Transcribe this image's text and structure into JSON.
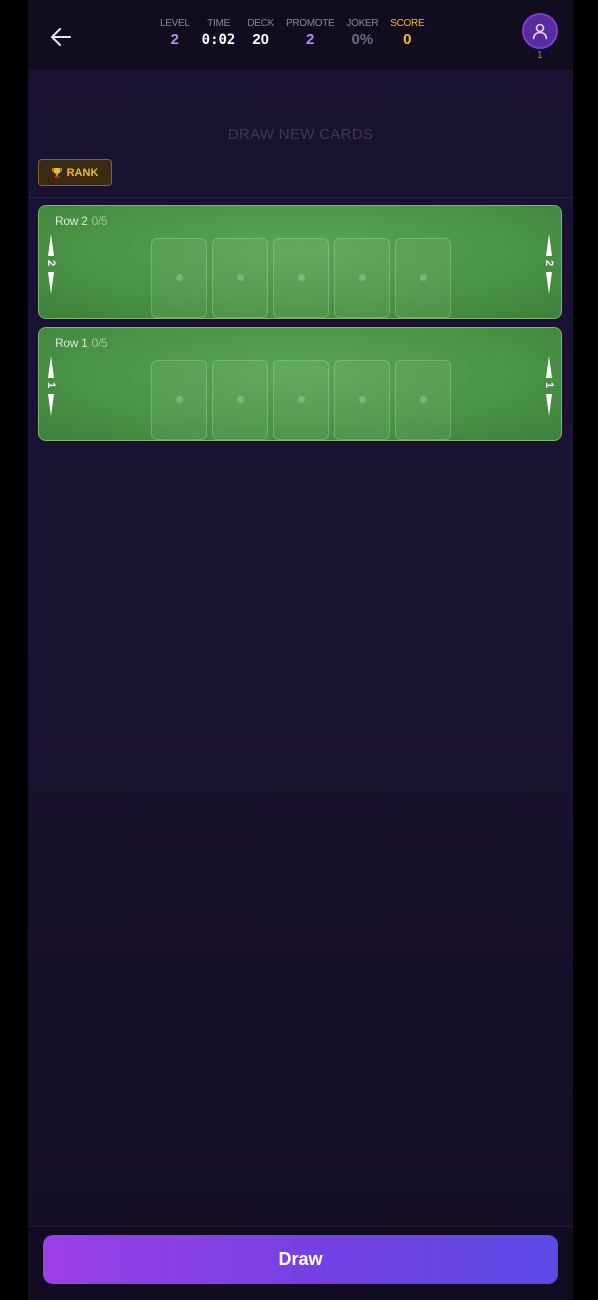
{
  "header": {
    "stats": [
      {
        "label": "LEVEL",
        "value": "2",
        "color": "#b88cf0"
      },
      {
        "label": "TIME",
        "value": "0:02",
        "color": "#ffffff"
      },
      {
        "label": "DECK",
        "value": "20",
        "color": "#ffffff"
      },
      {
        "label": "PROMOTE",
        "value": "2",
        "color": "#b88cf0"
      },
      {
        "label": "JOKER",
        "value": "0%",
        "color": "#6e6880"
      },
      {
        "label": "SCORE",
        "value": "0",
        "color": "#f0c020",
        "label_color": "#f0b92a"
      }
    ],
    "avatar_sub": "1"
  },
  "draw_hint": "DRAW NEW CARDS",
  "rank_button": {
    "label": "RANK"
  },
  "rows": [
    {
      "label": "Row 2",
      "count": "0/5",
      "marker": "2",
      "slots": 5
    },
    {
      "label": "Row 1",
      "count": "0/5",
      "marker": "1",
      "slots": 5
    }
  ],
  "draw_button": {
    "label": "Draw"
  },
  "colors": {
    "accent_purple": "#7b3fcf",
    "table_green": "#4b9547",
    "gold": "#f0b92a"
  }
}
